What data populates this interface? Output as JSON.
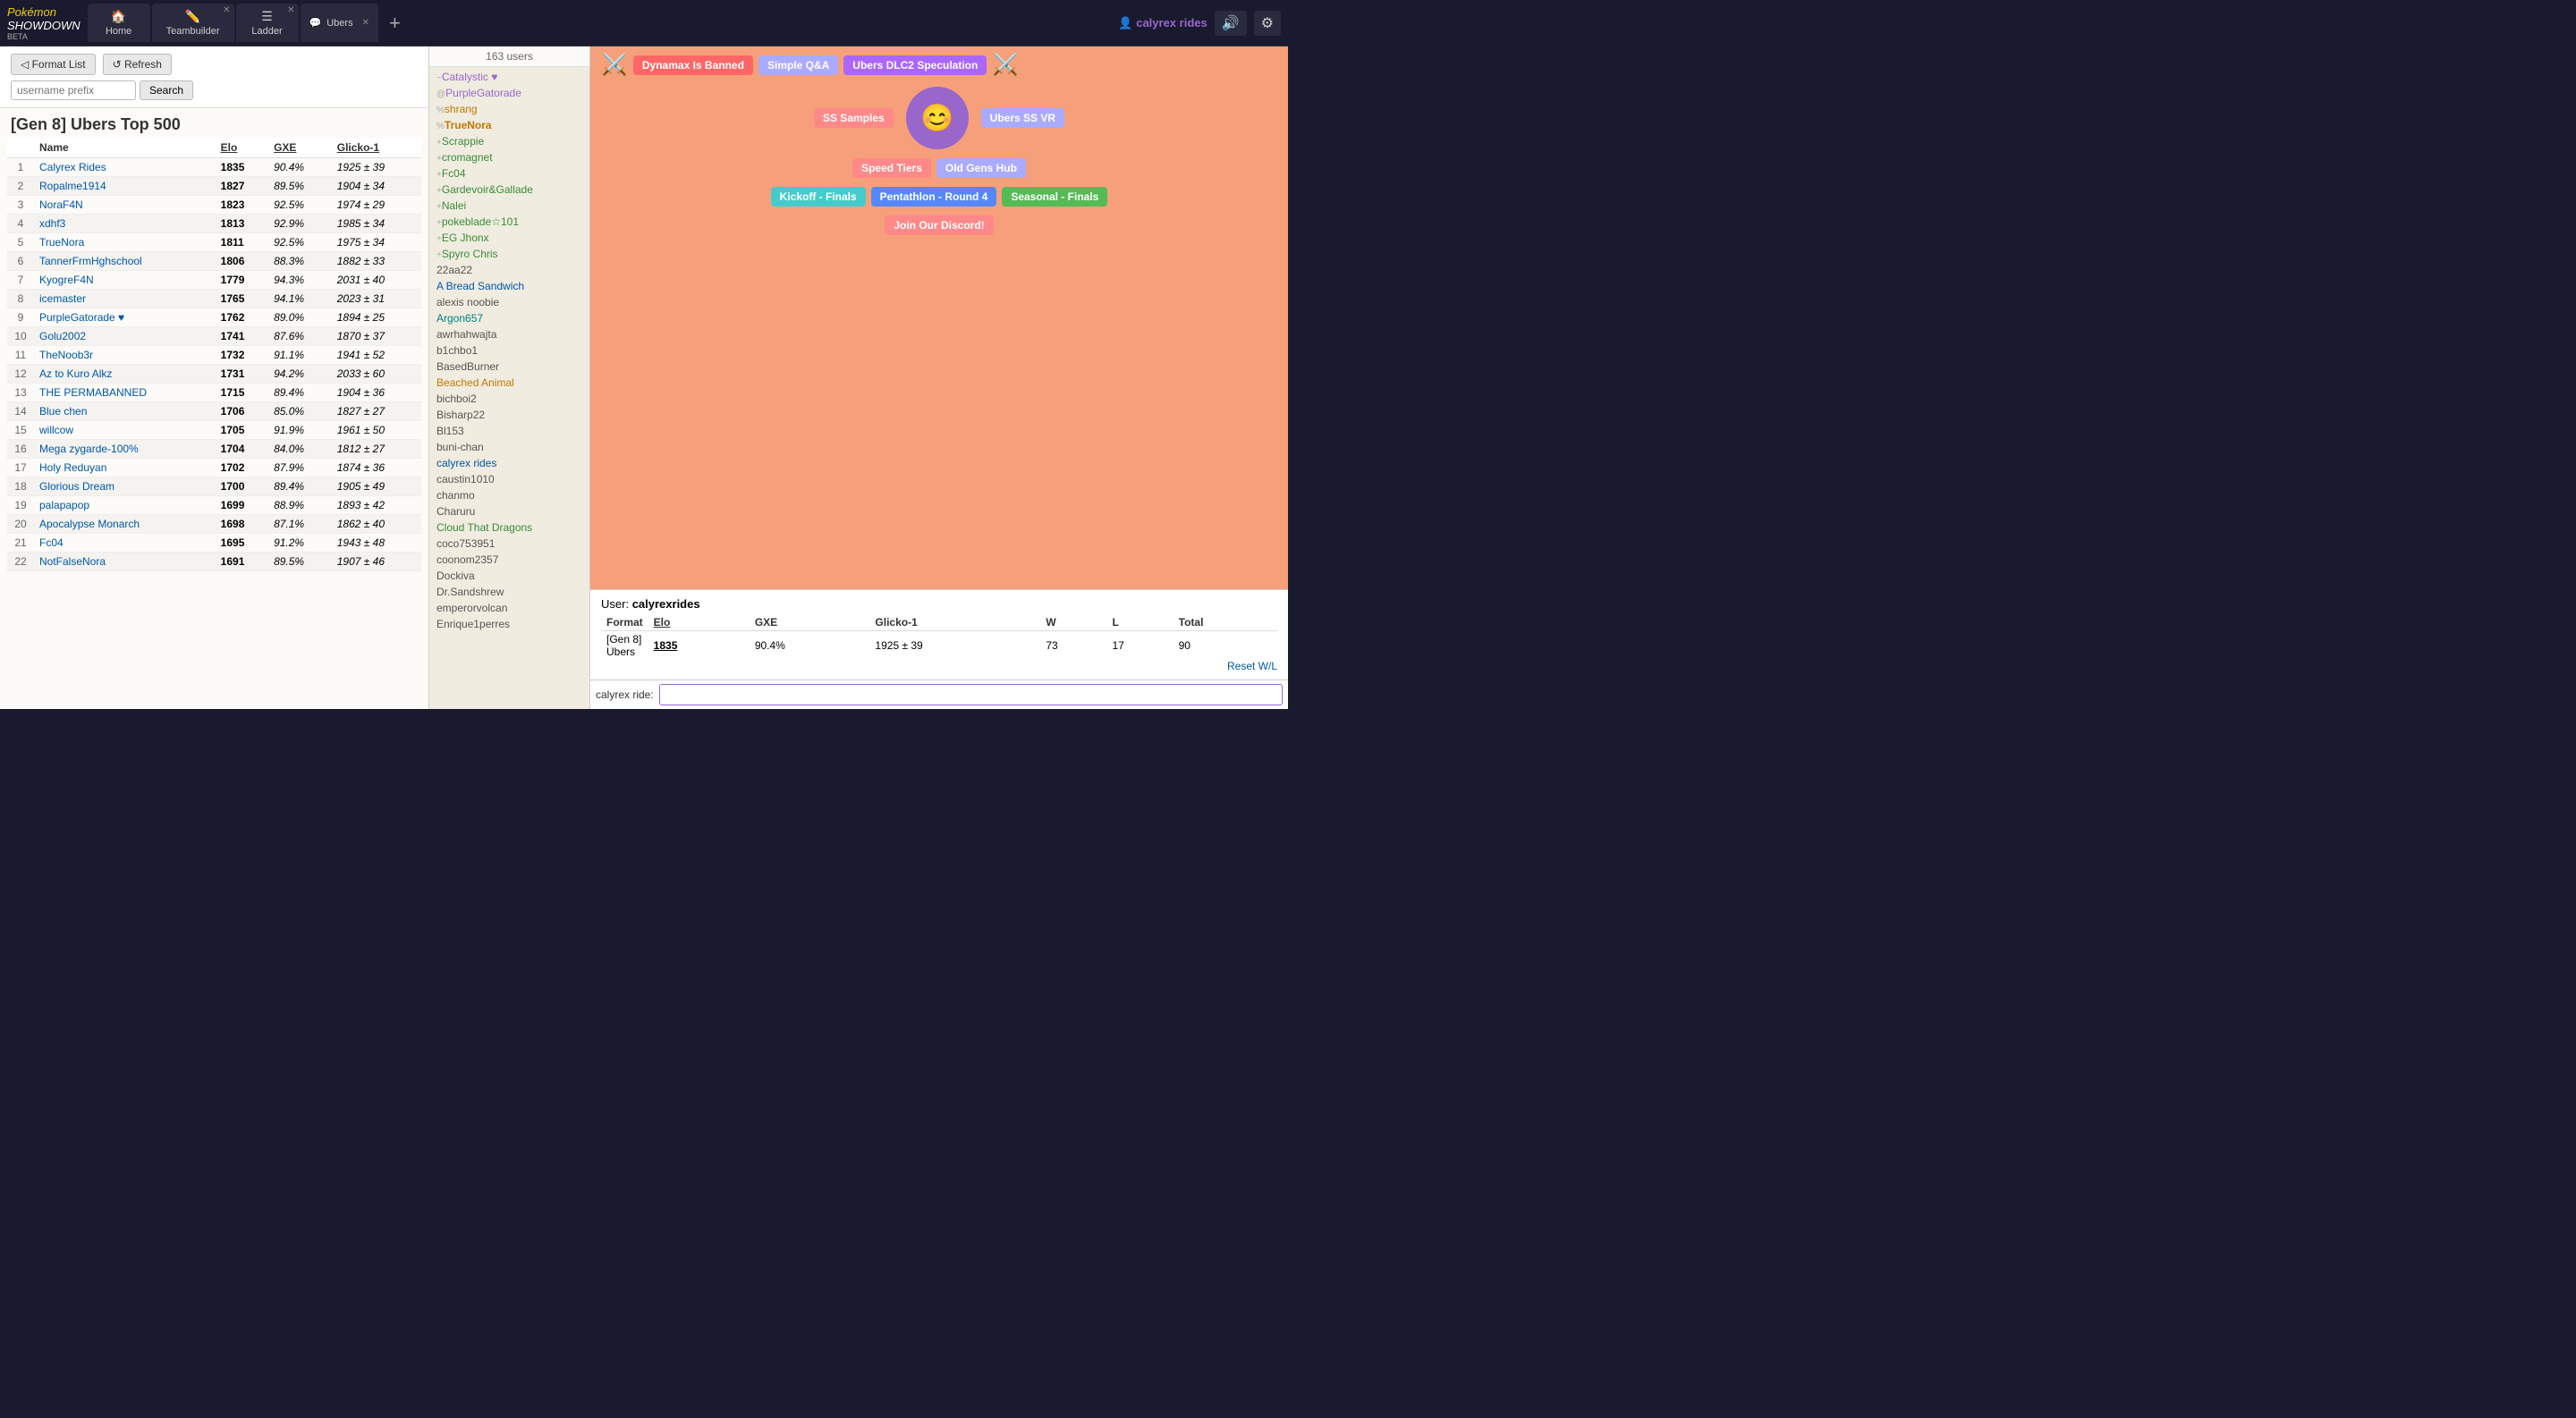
{
  "app": {
    "title": "Pokémon Showdown",
    "beta_label": "BETA"
  },
  "nav": {
    "tabs": [
      {
        "id": "home",
        "icon": "🏠",
        "label": "Home",
        "closable": false
      },
      {
        "id": "teambuilder",
        "icon": "✏️",
        "label": "Teambuilder",
        "closable": true
      },
      {
        "id": "ladder",
        "icon": "☰",
        "label": "Ladder",
        "closable": true
      }
    ],
    "chat_tab_label": "Ubers",
    "add_tab_label": "+",
    "user": "calyrex rides",
    "settings_icon": "⚙",
    "volume_icon": "🔊"
  },
  "left_panel": {
    "format_list_btn": "◁ Format List",
    "refresh_btn": "↺ Refresh",
    "search_placeholder": "username prefix",
    "search_btn": "Search",
    "title": "[Gen 8] Ubers Top 500",
    "table": {
      "headers": [
        "",
        "Name",
        "Elo",
        "GXE",
        "Glicko-1"
      ],
      "rows": [
        {
          "rank": 1,
          "name": "Calyrex Rides",
          "elo": "1835",
          "gxe": "90.4%",
          "glicko": "1925 ± 39"
        },
        {
          "rank": 2,
          "name": "Ropalme1914",
          "elo": "1827",
          "gxe": "89.5%",
          "glicko": "1904 ± 34"
        },
        {
          "rank": 3,
          "name": "NoraF4N",
          "elo": "1823",
          "gxe": "92.5%",
          "glicko": "1974 ± 29"
        },
        {
          "rank": 4,
          "name": "xdhf3",
          "elo": "1813",
          "gxe": "92.9%",
          "glicko": "1985 ± 34"
        },
        {
          "rank": 5,
          "name": "TrueNora",
          "elo": "1811",
          "gxe": "92.5%",
          "glicko": "1975 ± 34"
        },
        {
          "rank": 6,
          "name": "TannerFrmHghschool",
          "elo": "1806",
          "gxe": "88.3%",
          "glicko": "1882 ± 33"
        },
        {
          "rank": 7,
          "name": "KyogreF4N",
          "elo": "1779",
          "gxe": "94.3%",
          "glicko": "2031 ± 40"
        },
        {
          "rank": 8,
          "name": "icemaster",
          "elo": "1765",
          "gxe": "94.1%",
          "glicko": "2023 ± 31"
        },
        {
          "rank": 9,
          "name": "PurpleGatorade ♥",
          "elo": "1762",
          "gxe": "89.0%",
          "glicko": "1894 ± 25"
        },
        {
          "rank": 10,
          "name": "Golu2002",
          "elo": "1741",
          "gxe": "87.6%",
          "glicko": "1870 ± 37"
        },
        {
          "rank": 11,
          "name": "TheNoob3r",
          "elo": "1732",
          "gxe": "91.1%",
          "glicko": "1941 ± 52"
        },
        {
          "rank": 12,
          "name": "Az to Kuro Alkz",
          "elo": "1731",
          "gxe": "94.2%",
          "glicko": "2033 ± 60"
        },
        {
          "rank": 13,
          "name": "THE PERMABANNED",
          "elo": "1715",
          "gxe": "89.4%",
          "glicko": "1904 ± 36"
        },
        {
          "rank": 14,
          "name": "Blue chen",
          "elo": "1706",
          "gxe": "85.0%",
          "glicko": "1827 ± 27"
        },
        {
          "rank": 15,
          "name": "willcow",
          "elo": "1705",
          "gxe": "91.9%",
          "glicko": "1961 ± 50"
        },
        {
          "rank": 16,
          "name": "Mega zygarde-100%",
          "elo": "1704",
          "gxe": "84.0%",
          "glicko": "1812 ± 27"
        },
        {
          "rank": 17,
          "name": "Holy Reduyan",
          "elo": "1702",
          "gxe": "87.9%",
          "glicko": "1874 ± 36"
        },
        {
          "rank": 18,
          "name": "Glorious Dream",
          "elo": "1700",
          "gxe": "89.4%",
          "glicko": "1905 ± 49"
        },
        {
          "rank": 19,
          "name": "palapapop",
          "elo": "1699",
          "gxe": "88.9%",
          "glicko": "1893 ± 42"
        },
        {
          "rank": 20,
          "name": "Apocalypse Monarch",
          "elo": "1698",
          "gxe": "87.1%",
          "glicko": "1862 ± 40"
        },
        {
          "rank": 21,
          "name": "Fc04",
          "elo": "1695",
          "gxe": "91.2%",
          "glicko": "1943 ± 48"
        },
        {
          "rank": 22,
          "name": "NotFalseNora",
          "elo": "1691",
          "gxe": "89.5%",
          "glicko": "1907 ± 46"
        }
      ]
    }
  },
  "chat_panel": {
    "users_count": "163 users",
    "users": [
      {
        "rank": "~",
        "name": "Catalystic ♥",
        "color": "purple"
      },
      {
        "rank": "@",
        "name": "PurpleGatorade",
        "color": "purple"
      },
      {
        "rank": "%",
        "name": "shrang",
        "color": "orange"
      },
      {
        "rank": "%",
        "name": "TrueNora",
        "color": "orange",
        "bold": true
      },
      {
        "rank": "+",
        "name": "Scrappie",
        "color": "green"
      },
      {
        "rank": "+",
        "name": "cromagnet",
        "color": "green"
      },
      {
        "rank": "+",
        "name": "Fc04",
        "color": "green"
      },
      {
        "rank": "+",
        "name": "Gardevoir&Gallade",
        "color": "green"
      },
      {
        "rank": "+",
        "name": "Nalei",
        "color": "green"
      },
      {
        "rank": "+",
        "name": "pokeblade☆101",
        "color": "green"
      },
      {
        "rank": "+",
        "name": "EG Jhonx",
        "color": "green"
      },
      {
        "rank": "+",
        "name": "Spyro Chris",
        "color": "green"
      },
      {
        "rank": " ",
        "name": "22aa22",
        "color": "gray"
      },
      {
        "rank": " ",
        "name": "A Bread Sandwich",
        "color": "blue"
      },
      {
        "rank": " ",
        "name": "alexis noobie",
        "color": "gray"
      },
      {
        "rank": " ",
        "name": "Argon657",
        "color": "teal"
      },
      {
        "rank": " ",
        "name": "awrhahwajta",
        "color": "gray"
      },
      {
        "rank": " ",
        "name": "b1chbo1",
        "color": "gray"
      },
      {
        "rank": " ",
        "name": "BasedBurner",
        "color": "gray"
      },
      {
        "rank": " ",
        "name": "Beached Animal",
        "color": "orange"
      },
      {
        "rank": " ",
        "name": "bichboi2",
        "color": "gray"
      },
      {
        "rank": " ",
        "name": "Bisharp22",
        "color": "gray"
      },
      {
        "rank": " ",
        "name": "Bl153",
        "color": "gray"
      },
      {
        "rank": " ",
        "name": "buni-chan",
        "color": "gray"
      },
      {
        "rank": " ",
        "name": "calyrex rides",
        "color": "blue"
      },
      {
        "rank": " ",
        "name": "caustin1010",
        "color": "gray"
      },
      {
        "rank": " ",
        "name": "chanmo",
        "color": "gray"
      },
      {
        "rank": " ",
        "name": "Charuru",
        "color": "gray"
      },
      {
        "rank": " ",
        "name": "Cloud That Dragons",
        "color": "green"
      },
      {
        "rank": " ",
        "name": "coco753951",
        "color": "gray"
      },
      {
        "rank": " ",
        "name": "coonom2357",
        "color": "gray"
      },
      {
        "rank": " ",
        "name": "Dockiva",
        "color": "gray"
      },
      {
        "rank": " ",
        "name": "Dr.Sandshrew",
        "color": "gray"
      },
      {
        "rank": " ",
        "name": "emperorvolcan",
        "color": "gray"
      },
      {
        "rank": " ",
        "name": "Enrique1perres",
        "color": "gray"
      }
    ]
  },
  "right_panel": {
    "banner": {
      "tags": [
        {
          "label": "Dynamax Is Banned",
          "style": "dynamax"
        },
        {
          "label": "Simple Q&A",
          "style": "simple"
        },
        {
          "label": "Ubers DLC2 Speculation",
          "style": "dlc"
        },
        {
          "label": "SS Samples",
          "style": "ss-samples"
        },
        {
          "label": "Ubers SS VR",
          "style": "ubers-ss-vr"
        },
        {
          "label": "Speed Tiers",
          "style": "speed"
        },
        {
          "label": "Old Gens Hub",
          "style": "old-gens"
        },
        {
          "label": "Kickoff - Finals",
          "style": "kickoff"
        },
        {
          "label": "Pentathlon - Round 4",
          "style": "penta"
        },
        {
          "label": "Seasonal - Finals",
          "style": "seasonal"
        },
        {
          "label": "Join Our Discord!",
          "style": "discord"
        }
      ]
    },
    "user_stats": {
      "user_label": "User:",
      "username": "calyrexrides",
      "table_headers": [
        "Format",
        "Elo",
        "GXE",
        "Glicko-1",
        "W",
        "L",
        "Total"
      ],
      "row": {
        "format": "[Gen 8] Ubers",
        "elo": "1835",
        "gxe": "90.4%",
        "glicko": "1925 ± 39",
        "w": "73",
        "l": "17",
        "total": "90"
      },
      "reset_link": "Reset W/L"
    },
    "chat_input": {
      "username_label": "calyrex ride:",
      "placeholder": ""
    }
  }
}
